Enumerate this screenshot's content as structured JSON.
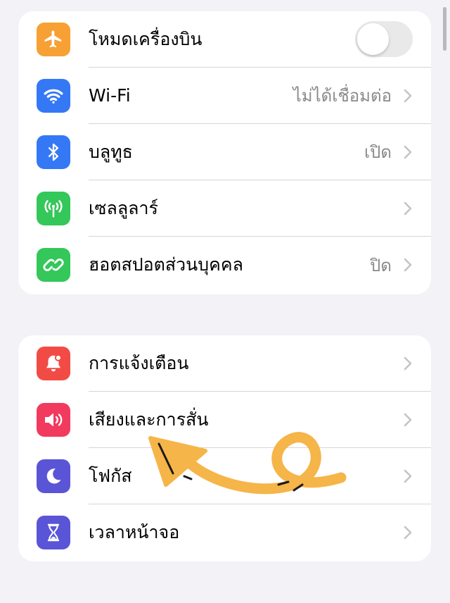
{
  "group1": {
    "items": [
      {
        "label": "โหมดเครื่องบิน",
        "icon": "airplane-icon",
        "color": "#f7a033",
        "toggle_on": false
      },
      {
        "label": "Wi-Fi",
        "value": "ไม่ได้เชื่อมต่อ",
        "icon": "wifi-icon",
        "color": "#3478f6"
      },
      {
        "label": "บลูทูธ",
        "value": "เปิด",
        "icon": "bluetooth-icon",
        "color": "#3478f6"
      },
      {
        "label": "เซลลูลาร์",
        "value": "",
        "icon": "antenna-icon",
        "color": "#34c759"
      },
      {
        "label": "ฮอตสปอตส่วนบุคคล",
        "value": "ปิด",
        "icon": "hotspot-icon",
        "color": "#34c759"
      }
    ]
  },
  "group2": {
    "items": [
      {
        "label": "การแจ้งเตือน",
        "icon": "bell-icon",
        "color": "#f24b45"
      },
      {
        "label": "เสียงและการสั่น",
        "icon": "speaker-icon",
        "color": "#f23a5e"
      },
      {
        "label": "โฟกัส",
        "icon": "moon-icon",
        "color": "#5a55d6"
      },
      {
        "label": "เวลาหน้าจอ",
        "icon": "hourglass-icon",
        "color": "#5a55d6"
      }
    ]
  },
  "annotation_color": "#f5b548"
}
